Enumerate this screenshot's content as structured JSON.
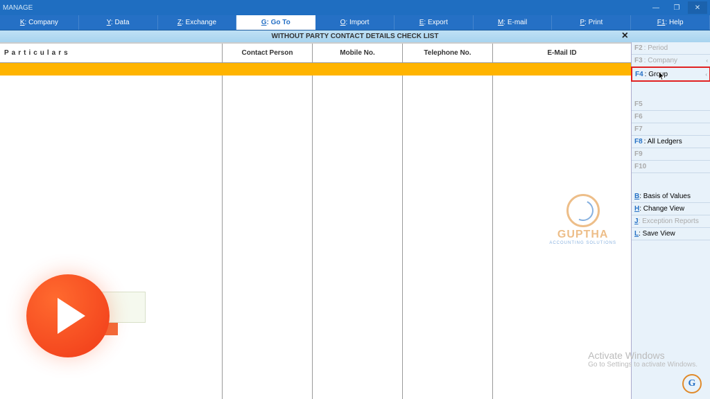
{
  "titlebar": {
    "title": "MANAGE"
  },
  "menu": {
    "company": {
      "key": "K",
      "label": ": Company"
    },
    "data": {
      "key": "Y",
      "label": ": Data"
    },
    "exchange": {
      "key": "Z",
      "label": ": Exchange"
    },
    "goto": {
      "key": "G",
      "label": ": Go To"
    },
    "import": {
      "key": "O",
      "label": ": Import"
    },
    "export": {
      "key": "E",
      "label": ": Export"
    },
    "email": {
      "key": "M",
      "label": ": E-mail"
    },
    "print": {
      "key": "P",
      "label": ": Print"
    },
    "help": {
      "key": "F1",
      "label": ": Help"
    }
  },
  "subheader": "WITHOUT PARTY CONTACT DETAILS CHECK LIST",
  "table": {
    "particulars": "Particulars",
    "contact": "Contact Person",
    "mobile": "Mobile No.",
    "telephone": "Telephone No.",
    "email": "E-Mail ID"
  },
  "side": {
    "f2": {
      "key": "F2",
      "label": ": Period"
    },
    "f3": {
      "key": "F3",
      "label": ": Company"
    },
    "f4": {
      "key": "F4",
      "label": ": Group"
    },
    "f5": {
      "key": "F5",
      "label": ""
    },
    "f6": {
      "key": "F6",
      "label": ""
    },
    "f7": {
      "key": "F7",
      "label": ""
    },
    "f8": {
      "key": "F8",
      "label": ": All Ledgers"
    },
    "f9": {
      "key": "F9",
      "label": ""
    },
    "f10": {
      "key": "F10",
      "label": ""
    },
    "b": {
      "key": "B",
      "label": ": Basis of Values"
    },
    "h": {
      "key": "H",
      "label": ": Change View"
    },
    "j": {
      "key": "J",
      "label": ": Exception Reports"
    },
    "l": {
      "key": "L",
      "label": ": Save View"
    }
  },
  "watermark": {
    "name": "GUPTHA",
    "sub": "ACCOUNTING SOLUTIONS"
  },
  "activate": {
    "line1": "Activate Windows",
    "line2": "Go to Settings to activate Windows."
  }
}
